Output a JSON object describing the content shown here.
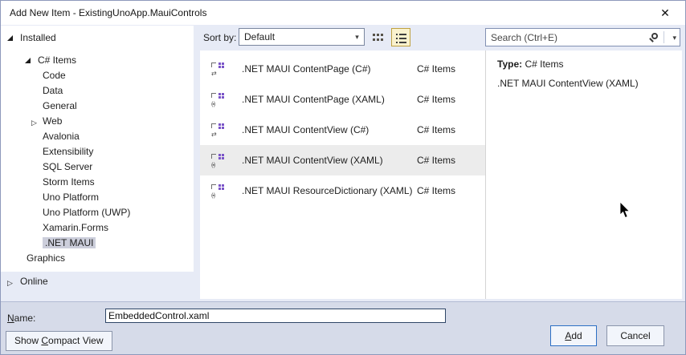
{
  "window": {
    "title": "Add New Item - ExistingUnoApp.MauiControls"
  },
  "icons": {
    "close": "✕",
    "dropdown_arrow": "▾",
    "collapsed_triangle": "▷",
    "cs_template_glyph": "⇄",
    "xaml_template_glyph": "(▪)"
  },
  "toolbar": {
    "sort_label": "Sort by:",
    "sort_value": "Default",
    "search_placeholder": "Search (Ctrl+E)"
  },
  "tree": {
    "installed_label": "Installed",
    "online_label": "Online",
    "selected_item": ".NET MAUI",
    "items": [
      {
        "label": "C# Items"
      },
      {
        "label": "Code"
      },
      {
        "label": "Data"
      },
      {
        "label": "General"
      },
      {
        "label": "Web"
      },
      {
        "label": "Avalonia"
      },
      {
        "label": "Extensibility"
      },
      {
        "label": "SQL Server"
      },
      {
        "label": "Storm Items"
      },
      {
        "label": "Uno Platform"
      },
      {
        "label": "Uno Platform (UWP)"
      },
      {
        "label": "Xamarin.Forms"
      },
      {
        "label": ".NET MAUI"
      },
      {
        "label": "Graphics"
      }
    ]
  },
  "list": {
    "selected_index": 3,
    "items": [
      {
        "label": ".NET MAUI ContentPage (C#)",
        "type": "C# Items"
      },
      {
        "label": ".NET MAUI ContentPage (XAML)",
        "type": "C# Items"
      },
      {
        "label": ".NET MAUI ContentView (C#)",
        "type": "C# Items"
      },
      {
        "label": ".NET MAUI ContentView (XAML)",
        "type": "C# Items"
      },
      {
        "label": ".NET MAUI ResourceDictionary (XAML)",
        "type": "C# Items"
      }
    ]
  },
  "details": {
    "type_label": "Type:",
    "type_value": "C# Items",
    "description": ".NET MAUI ContentView (XAML)"
  },
  "footer": {
    "name_label_u": "N",
    "name_label_rest": "ame:",
    "name_value": "EmbeddedControl.xaml",
    "compact_pre": "Show ",
    "compact_u": "C",
    "compact_rest": "ompact View",
    "add_u": "A",
    "add_rest": "dd",
    "cancel_label": "Cancel"
  },
  "colors": {
    "dialog_bg": "#e7ebf6",
    "bottom_strip_bg": "#d6dbe9",
    "tree_selection": "#cccedb",
    "list_selection": "#ececec",
    "view_toggle_active_bg": "#faf2cf",
    "view_toggle_active_border": "#bfa141",
    "template_icon_purple": "#7a54c8",
    "default_button_border": "#2c6fc4"
  }
}
